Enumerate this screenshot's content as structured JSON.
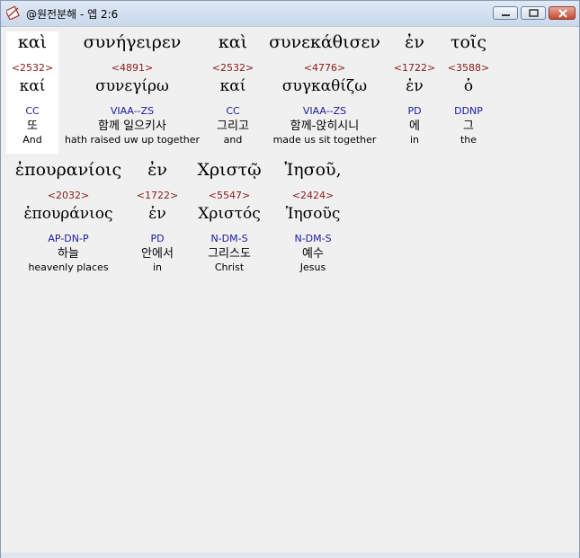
{
  "window": {
    "title": "@원전분해 - 엡 2:6"
  },
  "words": [
    {
      "surface": "καὶ",
      "strongs": "<2532>",
      "lemma": "καί",
      "morph": "CC",
      "korean": "또",
      "english": "And"
    },
    {
      "surface": "συνήγειρεν",
      "strongs": "<4891>",
      "lemma": "συνεγίρω",
      "morph": "VIAA--ZS",
      "korean": "함께 일으키사",
      "english": "hath raised uw up together"
    },
    {
      "surface": "καὶ",
      "strongs": "<2532>",
      "lemma": "καί",
      "morph": "CC",
      "korean": "그리고",
      "english": "and"
    },
    {
      "surface": "συνεκάθισεν",
      "strongs": "<4776>",
      "lemma": "συγκαθίζω",
      "morph": "VIAA--ZS",
      "korean": "함께-앉히시니",
      "english": "made us sit together"
    },
    {
      "surface": "ἐν",
      "strongs": "<1722>",
      "lemma": "ἐν",
      "morph": "PD",
      "korean": "에",
      "english": "in"
    },
    {
      "surface": "τοῖς",
      "strongs": "<3588>",
      "lemma": "ὁ",
      "morph": "DDNP",
      "korean": "그",
      "english": "the"
    },
    {
      "surface": "ἐπουρανίοις",
      "strongs": "<2032>",
      "lemma": "ἐπουράνιος",
      "morph": "AP-DN-P",
      "korean": "하늘",
      "english": "heavenly places"
    },
    {
      "surface": "ἐν",
      "strongs": "<1722>",
      "lemma": "ἐν",
      "morph": "PD",
      "korean": "안에서",
      "english": "in"
    },
    {
      "surface": "Χριστῷ",
      "strongs": "<5547>",
      "lemma": "Χριστός",
      "morph": "N-DM-S",
      "korean": "그리스도",
      "english": "Christ"
    },
    {
      "surface": "Ἰησοῦ,",
      "strongs": "<2424>",
      "lemma": "Ἰησοῦς",
      "morph": "N-DM-S",
      "korean": "예수",
      "english": "Jesus"
    }
  ],
  "colors": {
    "strongs": "#8b1a1a",
    "morph": "#1a1aa0",
    "background": "#f0f0f0",
    "selected_background": "#ffffff"
  }
}
